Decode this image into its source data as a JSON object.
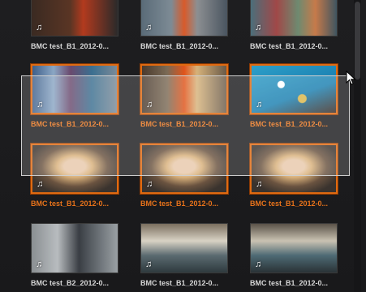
{
  "clips": [
    {
      "label": "BMC test_B1_2012-0...",
      "selected": false,
      "art": "woman-red-dark"
    },
    {
      "label": "BMC test_B1_2012-0...",
      "selected": false,
      "art": "woman-red-street"
    },
    {
      "label": "BMC test_B1_2012-0...",
      "selected": false,
      "art": "graffiti-alley"
    },
    {
      "label": "BMC test_B1_2012-0...",
      "selected": true,
      "art": "graffiti-wall"
    },
    {
      "label": "BMC test_B1_2012-0...",
      "selected": true,
      "art": "woman-orange-pool"
    },
    {
      "label": "BMC test_B1_2012-0...",
      "selected": true,
      "art": "pool-table"
    },
    {
      "label": "BMC test_B1_2012-0...",
      "selected": true,
      "art": "blonde-closeup"
    },
    {
      "label": "BMC test_B1_2012-0...",
      "selected": true,
      "art": "blonde-closeup"
    },
    {
      "label": "BMC test_B1_2012-0...",
      "selected": true,
      "art": "blonde-closeup"
    },
    {
      "label": "BMC test_B2_2012-0...",
      "selected": false,
      "art": "man-bar"
    },
    {
      "label": "BMC test_B1_2012-0...",
      "selected": false,
      "art": "pool-hall"
    },
    {
      "label": "BMC test_B1_2012-0...",
      "selected": false,
      "art": "pool-hall-wide"
    }
  ],
  "icons": {
    "audio": "music-note-icon",
    "cursor": "mouse-pointer-icon"
  },
  "colors": {
    "selection_accent": "#e06a10",
    "selected_label": "#e9731a",
    "label": "#d6d6d6",
    "background": "#1b1b1d"
  }
}
